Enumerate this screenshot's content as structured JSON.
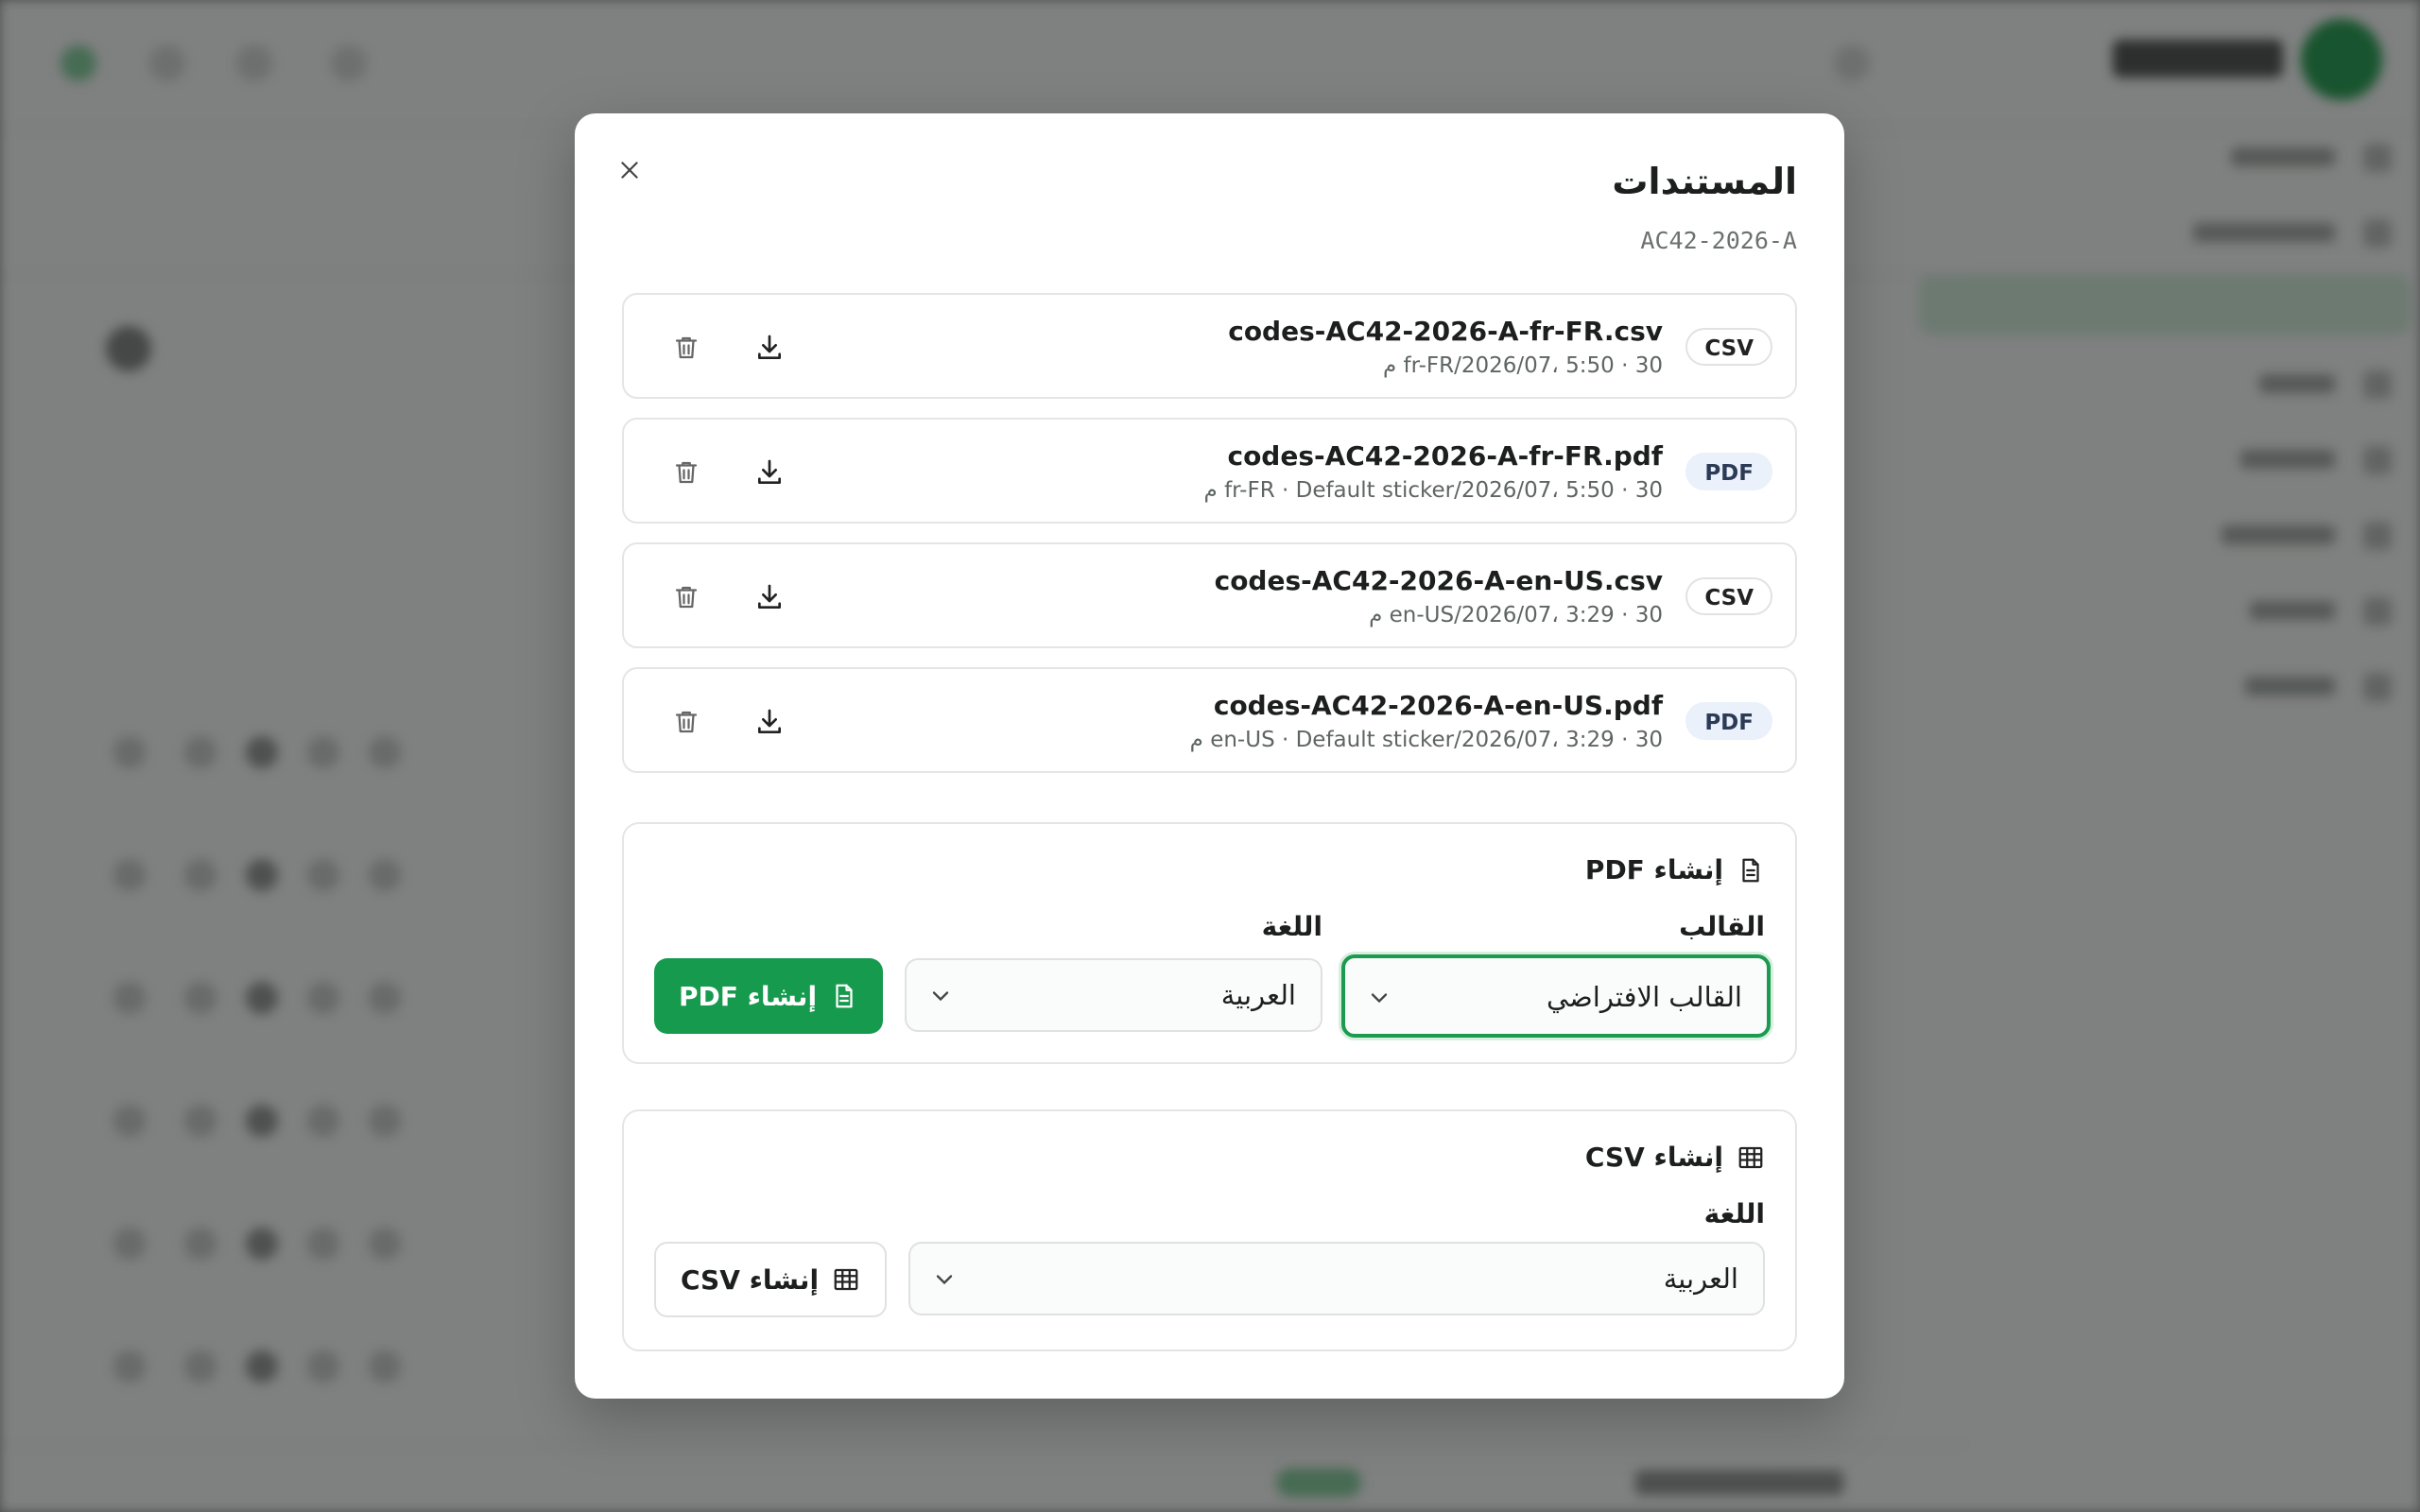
{
  "dialog": {
    "title": "المستندات",
    "subtitle": "AC42-2026-A"
  },
  "files": [
    {
      "type": "CSV",
      "name": "codes-AC42-2026-A-fr-FR.csv",
      "meta": "30 · fr-FR/2026/07، 5:50 م"
    },
    {
      "type": "PDF",
      "name": "codes-AC42-2026-A-fr-FR.pdf",
      "meta": "30 · fr-FR · Default sticker/2026/07، 5:50 م"
    },
    {
      "type": "CSV",
      "name": "codes-AC42-2026-A-en-US.csv",
      "meta": "30 · en-US/2026/07، 3:29 م"
    },
    {
      "type": "PDF",
      "name": "codes-AC42-2026-A-en-US.pdf",
      "meta": "30 · en-US · Default sticker/2026/07، 3:29 م"
    }
  ],
  "pdf_panel": {
    "title": "إنشاء PDF",
    "template_label": "القالب",
    "template_value": "القالب الافتراضي",
    "language_label": "اللغة",
    "language_value": "العربية",
    "button_label": "إنشاء PDF"
  },
  "csv_panel": {
    "title": "إنشاء CSV",
    "language_label": "اللغة",
    "language_value": "العربية",
    "button_label": "إنشاء CSV"
  },
  "colors": {
    "accent": "#169a4e",
    "pdf_badge_bg": "#eaf1fb"
  },
  "icons": {
    "close": "close-icon",
    "delete": "trash-icon",
    "download": "download-icon",
    "pdf": "file-text-icon",
    "csv": "table-icon",
    "chevron": "chevron-down-icon"
  }
}
